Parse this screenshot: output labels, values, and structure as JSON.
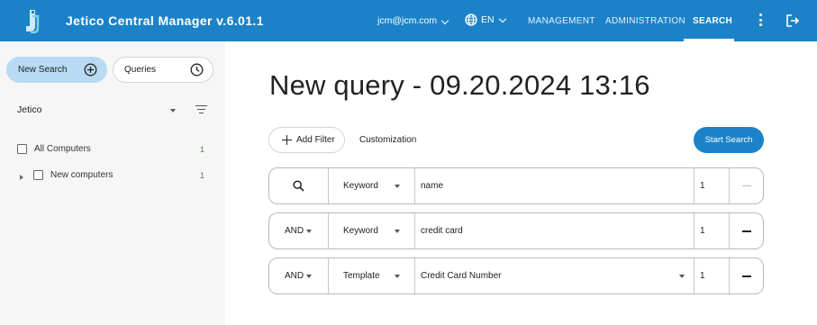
{
  "app": {
    "title": "Jetico Central Manager  v.6.01.1"
  },
  "header": {
    "user": "jcm@jcm.com",
    "language": "EN",
    "nav": [
      "MANAGEMENT",
      "ADMINISTRATION",
      "SEARCH"
    ],
    "active_nav": "SEARCH"
  },
  "sidebar": {
    "new_search_label": "New Search",
    "queries_label": "Queries",
    "group": "Jetico",
    "tree": [
      {
        "label": "All Computers",
        "count": "1"
      },
      {
        "label": "New computers",
        "count": "1"
      }
    ]
  },
  "main": {
    "title": "New query - 09.20.2024 13:16",
    "add_filter_label": "Add Filter",
    "customization_label": "Customization",
    "start_search_label": "Start Search",
    "filters": [
      {
        "operator": "",
        "type": "Keyword",
        "value": "name",
        "count": "1"
      },
      {
        "operator": "AND",
        "type": "Keyword",
        "value": "credit card",
        "count": "1"
      },
      {
        "operator": "AND",
        "type": "Template",
        "value": "Credit Card Number",
        "count": "1"
      }
    ]
  },
  "colors": {
    "primary": "#1b82c8",
    "selected_pill": "#b8dbf3",
    "count_green": "#3a9a3a"
  }
}
